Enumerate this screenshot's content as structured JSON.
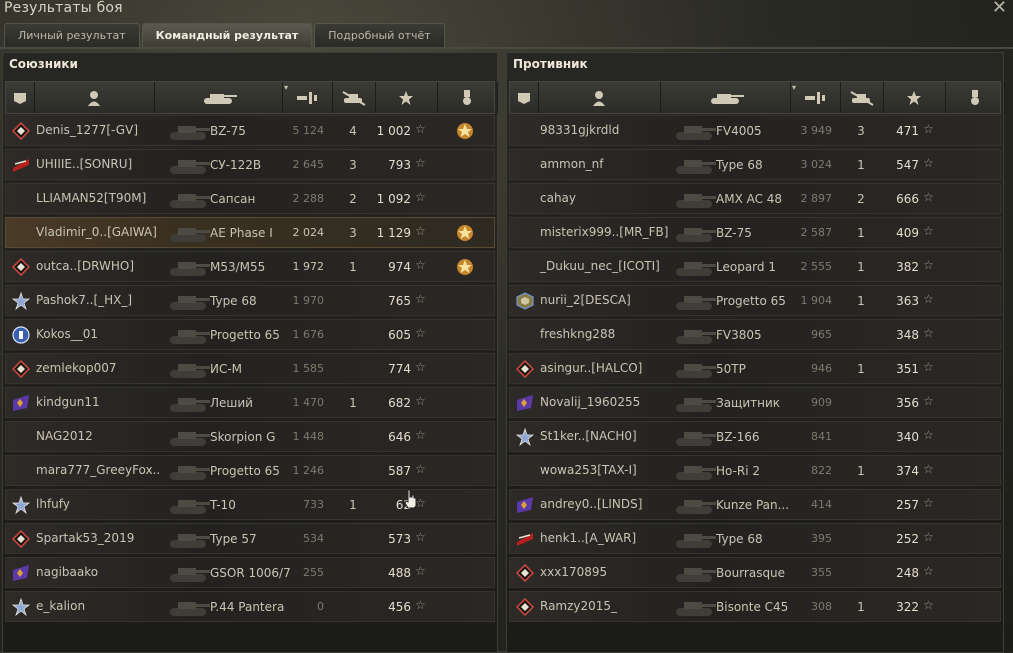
{
  "window": {
    "title": "Результаты боя",
    "close_label": "✕"
  },
  "tabs": [
    {
      "label": "Личный результат",
      "active": false
    },
    {
      "label": "Командный результат",
      "active": true
    },
    {
      "label": "Подробный отчёт",
      "active": false
    }
  ],
  "allies": {
    "title": "Союзники",
    "rows": [
      {
        "badge": "diamond-icon",
        "player": "Denis_1277[-GV]",
        "tank": "BZ-75",
        "damage": "5 124",
        "kills": "4",
        "xp": "1 002",
        "medal": true,
        "highlight": false,
        "dmg_hi": false
      },
      {
        "badge": "clan-flag-icon",
        "player": "UHIIIE..[SONRU]",
        "tank": "СУ-122В",
        "damage": "2 645",
        "kills": "3",
        "xp": "793",
        "medal": false,
        "highlight": false,
        "dmg_hi": false
      },
      {
        "badge": "",
        "player": "LLIAMAN52[T90M]",
        "tank": "Сапсан",
        "damage": "2 288",
        "kills": "2",
        "xp": "1 092",
        "medal": false,
        "highlight": false,
        "dmg_hi": false
      },
      {
        "badge": "",
        "player": "Vladimir_0..[GAIWA]",
        "tank": "AE Phase I",
        "damage": "2 024",
        "kills": "3",
        "xp": "1 129",
        "medal": true,
        "highlight": true,
        "dmg_hi": true
      },
      {
        "badge": "diamond-icon",
        "player": "outca..[DRWHO]",
        "tank": "M53/M55",
        "damage": "1 972",
        "kills": "1",
        "xp": "974",
        "medal": true,
        "highlight": false,
        "dmg_hi": true
      },
      {
        "badge": "star-badge-icon",
        "player": "Pashok7..[_HX_]",
        "tank": "Type 68",
        "damage": "1 970",
        "kills": "",
        "xp": "765",
        "medal": false,
        "highlight": false,
        "dmg_hi": false
      },
      {
        "badge": "round-badge-icon",
        "player": "Kokos__01",
        "tank": "Progetto 65",
        "damage": "1 676",
        "kills": "",
        "xp": "605",
        "medal": false,
        "highlight": false,
        "dmg_hi": false
      },
      {
        "badge": "diamond-icon",
        "player": "zemlekop007",
        "tank": "ИС-М",
        "damage": "1 585",
        "kills": "",
        "xp": "774",
        "medal": false,
        "highlight": false,
        "dmg_hi": false
      },
      {
        "badge": "flag-badge-icon",
        "player": "kindgun11",
        "tank": "Леший",
        "damage": "1 470",
        "kills": "1",
        "xp": "682",
        "medal": false,
        "highlight": false,
        "dmg_hi": false
      },
      {
        "badge": "",
        "player": "NAG2012",
        "tank": "Skorpion G",
        "damage": "1 448",
        "kills": "",
        "xp": "646",
        "medal": false,
        "highlight": false,
        "dmg_hi": false
      },
      {
        "badge": "",
        "player": "mara777_GreeyFox..",
        "tank": "Progetto 65",
        "damage": "1 246",
        "kills": "",
        "xp": "587",
        "medal": false,
        "highlight": false,
        "dmg_hi": false
      },
      {
        "badge": "star-badge-icon",
        "player": "lhfufy",
        "tank": "T-10",
        "damage": "733",
        "kills": "1",
        "xp": "62",
        "medal": false,
        "highlight": false,
        "dmg_hi": false
      },
      {
        "badge": "diamond-icon",
        "player": "Spartak53_2019",
        "tank": "Type 57",
        "damage": "534",
        "kills": "",
        "xp": "573",
        "medal": false,
        "highlight": false,
        "dmg_hi": false
      },
      {
        "badge": "flag-badge-icon",
        "player": "nagibaako",
        "tank": "GSOR 1006/7",
        "damage": "255",
        "kills": "",
        "xp": "488",
        "medal": false,
        "highlight": false,
        "dmg_hi": false
      },
      {
        "badge": "star-badge-icon",
        "player": "e_kalion",
        "tank": "P.44 Pantera",
        "damage": "0",
        "kills": "",
        "xp": "456",
        "medal": false,
        "highlight": false,
        "dmg_hi": false
      }
    ]
  },
  "enemies": {
    "title": "Противник",
    "rows": [
      {
        "badge": "",
        "player": "98331gjkrdld",
        "tank": "FV4005",
        "damage": "3 949",
        "kills": "3",
        "xp": "471"
      },
      {
        "badge": "",
        "player": "ammon_nf",
        "tank": "Type 68",
        "damage": "3 024",
        "kills": "1",
        "xp": "547"
      },
      {
        "badge": "",
        "player": "cahay",
        "tank": "AMX AC 48",
        "damage": "2 897",
        "kills": "2",
        "xp": "666"
      },
      {
        "badge": "",
        "player": "misterix999..[MR_FB]",
        "tank": "BZ-75",
        "damage": "2 587",
        "kills": "1",
        "xp": "409"
      },
      {
        "badge": "",
        "player": "_Dukuu_nec_[ICOTI]",
        "tank": "Leopard 1",
        "damage": "2 555",
        "kills": "1",
        "xp": "382"
      },
      {
        "badge": "cube-badge-icon",
        "player": "nurii_2[DESCA]",
        "tank": "Progetto 65",
        "damage": "1 904",
        "kills": "1",
        "xp": "363"
      },
      {
        "badge": "",
        "player": "freshkng288",
        "tank": "FV3805",
        "damage": "965",
        "kills": "",
        "xp": "348"
      },
      {
        "badge": "diamond-icon",
        "player": "asingur..[HALCO]",
        "tank": "50TP",
        "damage": "946",
        "kills": "1",
        "xp": "351"
      },
      {
        "badge": "flag-badge-icon",
        "player": "Novalij_1960255",
        "tank": "Защитник",
        "damage": "909",
        "kills": "",
        "xp": "356"
      },
      {
        "badge": "star-badge-icon",
        "player": "St1ker..[NACH0]",
        "tank": "BZ-166",
        "damage": "841",
        "kills": "",
        "xp": "340"
      },
      {
        "badge": "",
        "player": "wowa253[TAX-I]",
        "tank": "Ho-Ri 2",
        "damage": "822",
        "kills": "1",
        "xp": "374"
      },
      {
        "badge": "flag-badge-icon",
        "player": "andrey0..[LINDS]",
        "tank": "Kunze Pan...",
        "damage": "414",
        "kills": "",
        "xp": "257"
      },
      {
        "badge": "clan-flag-icon",
        "player": "henk1..[A_WAR]",
        "tank": "Type 68",
        "damage": "395",
        "kills": "",
        "xp": "252"
      },
      {
        "badge": "diamond-icon",
        "player": "xxx170895",
        "tank": "Bourrasque",
        "damage": "355",
        "kills": "",
        "xp": "248"
      },
      {
        "badge": "diamond-icon",
        "player": "Ramzy2015_",
        "tank": "Bisonte C45",
        "damage": "308",
        "kills": "1",
        "xp": "322"
      }
    ]
  },
  "columns": {
    "icons": [
      "squad-icon",
      "player-icon",
      "tank-icon",
      "damage-icon",
      "kills-icon",
      "xp-star-icon",
      "medal-icon"
    ],
    "sort_indicator": "▾"
  },
  "colors": {
    "highlight": "#4a3a28",
    "accent": "#e2ddcc",
    "star": "#9f9a8c"
  }
}
